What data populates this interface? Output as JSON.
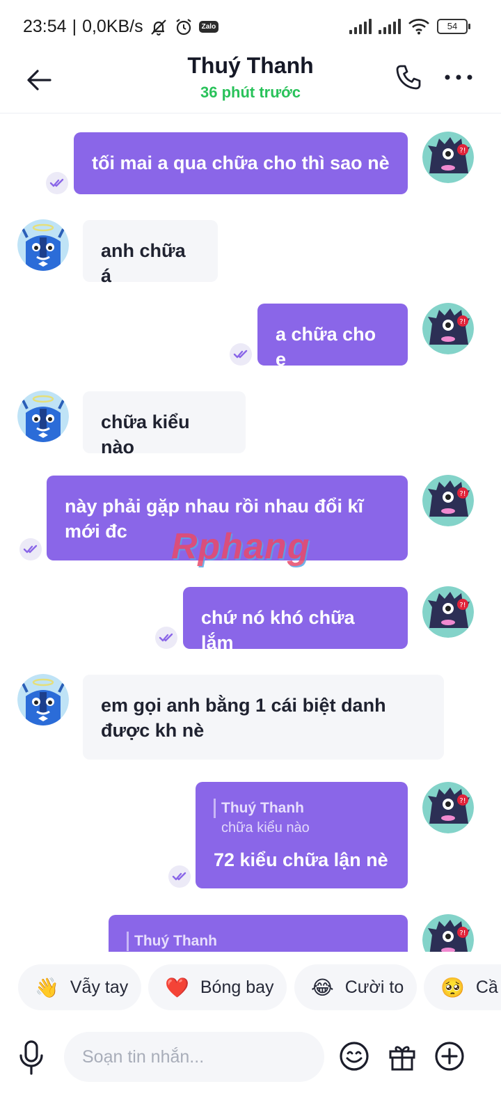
{
  "status": {
    "time": "23:54",
    "speed": "0,0KB/s",
    "battery": "54",
    "app_badge": "Zalo"
  },
  "header": {
    "title": "Thuý Thanh",
    "subtitle": "36 phút trước"
  },
  "messages": [
    {
      "dir": "out",
      "text": "tối mai a qua chữa cho thì sao nè"
    },
    {
      "dir": "in",
      "text": "anh chữa á"
    },
    {
      "dir": "out",
      "text": "a chữa cho e"
    },
    {
      "dir": "in",
      "text": "chữa kiểu nào"
    },
    {
      "dir": "out",
      "text": "này phải gặp nhau rồi nhau đổi kĩ mới đc"
    },
    {
      "dir": "out",
      "text": "chứ nó khó chữa lắm"
    },
    {
      "dir": "in",
      "text": "em gọi anh bằng 1 cái biệt danh được kh nè"
    },
    {
      "dir": "out",
      "quote_name": "Thuý Thanh",
      "quote_text": "chữa kiểu nào",
      "text": "72 kiểu chữa lận nè"
    },
    {
      "dir": "out",
      "quote_name": "Thuý Thanh"
    }
  ],
  "watermark": "Rphang",
  "quick_replies": [
    {
      "emoji": "👋",
      "label": "Vẫy tay"
    },
    {
      "emoji": "❤️",
      "label": "Bóng bay"
    },
    {
      "emoji": "😂",
      "label": "Cười to"
    },
    {
      "emoji": "🥺",
      "label": "Cầ"
    }
  ],
  "composer": {
    "placeholder": "Soạn tin nhắn..."
  },
  "colors": {
    "accent": "#8a66e8",
    "online": "#29c25a",
    "incoming_bubble": "#f5f6f9"
  }
}
